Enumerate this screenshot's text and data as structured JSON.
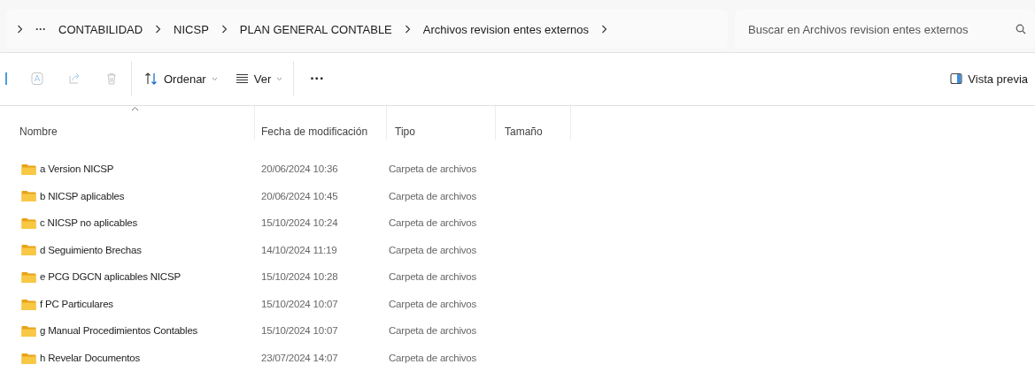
{
  "breadcrumb": {
    "overflow": "···",
    "items": [
      "CONTABILIDAD",
      "NICSP",
      "PLAN GENERAL CONTABLE",
      "Archivos revision entes externos"
    ]
  },
  "search": {
    "placeholder": "Buscar en Archivos revision entes externos"
  },
  "toolbar": {
    "actions": [
      {
        "kind": "rename",
        "disabled": true
      },
      {
        "kind": "share",
        "disabled": true
      },
      {
        "kind": "delete",
        "disabled": true
      }
    ],
    "menus": [
      {
        "kind": "sort",
        "label": "Ordenar"
      },
      {
        "kind": "view",
        "label": "Ver"
      }
    ],
    "more": "···",
    "preview": "Vista previa"
  },
  "table": {
    "columns": [
      "Nombre",
      "Fecha de modificación",
      "Tipo",
      "Tamaño"
    ],
    "rows": [
      {
        "name": "a Version NICSP",
        "modified": "20/06/2024 10:36",
        "type": "Carpeta de archivos"
      },
      {
        "name": "b NICSP aplicables",
        "modified": "20/06/2024 10:45",
        "type": "Carpeta de archivos"
      },
      {
        "name": "c NICSP no aplicables",
        "modified": "15/10/2024 10:24",
        "type": "Carpeta de archivos"
      },
      {
        "name": "d Seguimiento Brechas",
        "modified": "14/10/2024 11:19",
        "type": "Carpeta de archivos"
      },
      {
        "name": "e PCG DGCN aplicables NICSP",
        "modified": "15/10/2024 10:28",
        "type": "Carpeta de archivos"
      },
      {
        "name": "f PC Particulares",
        "modified": "15/10/2024 10:07",
        "type": "Carpeta de archivos"
      },
      {
        "name": "g Manual Procedimientos Contables",
        "modified": "15/10/2024 10:07",
        "type": "Carpeta de archivos"
      },
      {
        "name": "h Revelar Documentos",
        "modified": "23/07/2024 14:07",
        "type": "Carpeta de archivos"
      }
    ]
  }
}
